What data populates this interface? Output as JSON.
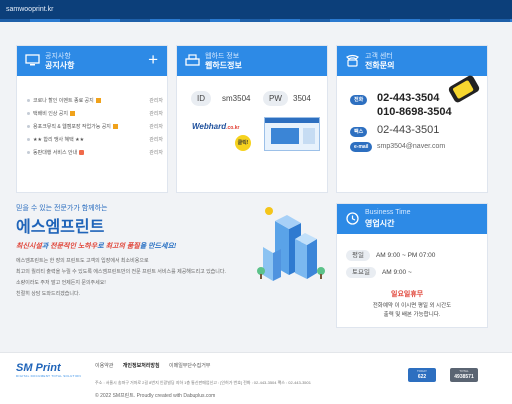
{
  "topbar": {
    "brand": "samwooprint.kr"
  },
  "notice": {
    "title_en": "공지사항",
    "title": "공지사항",
    "plus": "+",
    "items": [
      {
        "text": "코로나 할인 이벤트 종료 공지",
        "who": "관리자"
      },
      {
        "text": "택배비 인상 공지",
        "who": "관리자"
      },
      {
        "text": "용포크뮤직 & 웹캠포장 작업가능 공지",
        "who": "관리자"
      },
      {
        "text": "★★ 합리 맹사 혜택 ★★",
        "who": "관리자"
      },
      {
        "text": "동판대행 서비스 안내",
        "who": "관리자"
      }
    ]
  },
  "webhard": {
    "title_en": "웹하드 정보",
    "title": "웹하드정보",
    "id_label": "ID",
    "id_value": "sm3504",
    "pw_label": "PW",
    "pw_value": "3504",
    "logo_main": "Webhard",
    "logo_tld": ".co.kr",
    "click": "클릭!"
  },
  "cs": {
    "title_en": "고객 센터",
    "title": "전화문의",
    "tel_label": "전화",
    "tel1": "02-443-3504",
    "tel2": "010-8698-3504",
    "fax_label": "팩스",
    "fax": "02-443-3501",
    "mail_label": "e-mail",
    "mail": "smp3504@naver.com"
  },
  "intro": {
    "small": "믿을 수 있는 전문가가 함께하는",
    "big": "에스엠프린트",
    "sub_a": "최신시설",
    "sub_b": "과 ",
    "sub_c": "전문적인 노하우",
    "sub_d": "로 ",
    "sub_e": "최고의 품질",
    "sub_f": "을 만드세요!",
    "p1": "에스엠프린트는 한 장의 프린트도 고객의 입장에서 최소비용으로",
    "p2": "최고의 퀄리티 출력을 누릴 수 있도록 에스엠프린트만의 전문 프린트 서비스를 제공해드리고 있습니다.",
    "p3": "소량이라도 주저 말고 언제든지 문의주세요!",
    "p4": "친절히 상담 도와드리겠습니다."
  },
  "business": {
    "title_en": "Business Time",
    "title": "영업시간",
    "weekday_label": "평일",
    "weekday_time": "AM 9:00 ~ PM 07:00",
    "sat_label": "토요일",
    "sat_time": "AM 9:00 ~",
    "holiday": "일요일휴무",
    "note1": "전화예약 이 이시면 평일 외 시간도",
    "note2": "출력 및 배본 가능합니다."
  },
  "footer": {
    "logo": "SM Print",
    "logo_sub": "DIGITAL DOCUMENT TOTAL SOLUTION",
    "link1": "이용약관",
    "link2": "개인정보처리방침",
    "link3": "이메일무단수집거부",
    "addr": "주소 : 서울시 송파구 거마로 2길 8번지 인광빌딩 지하 1층 통신판매업신고 : [인허가 번호] 전화 : 02-443-3504 팩스 : 02-443-3501",
    "copy": "© 2022 SM프린트. Proudly created with Dabuplus.com",
    "today_label": "TODAY",
    "today_value": "622",
    "total_label": "TOTAL",
    "total_value": "4938571",
    "today_color": "#2d6fc0",
    "total_color": "#5a6472"
  }
}
